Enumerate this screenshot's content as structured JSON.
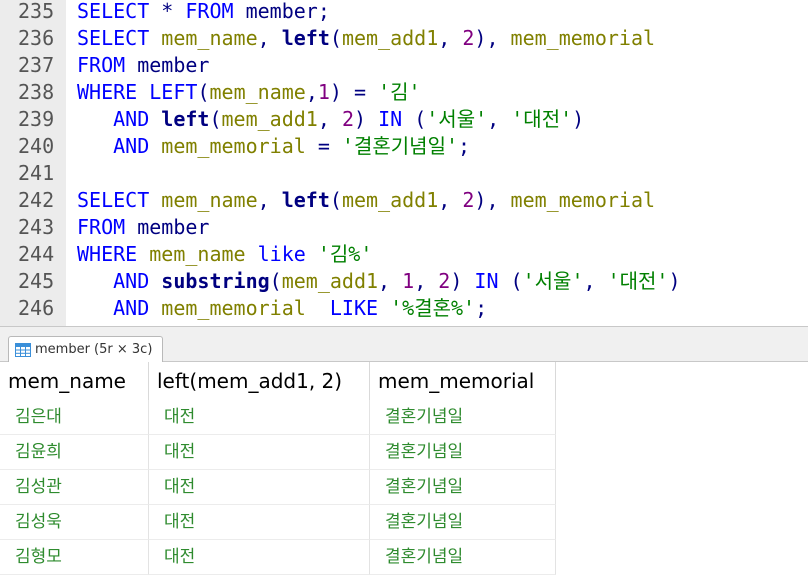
{
  "editor": {
    "lines": [
      {
        "n": "235",
        "tokens": [
          {
            "t": "SELECT",
            "c": "kw"
          },
          {
            "t": " * ",
            "c": "op"
          },
          {
            "t": "FROM",
            "c": "kw"
          },
          {
            "t": " member;",
            "c": "op"
          }
        ]
      },
      {
        "n": "236",
        "tokens": [
          {
            "t": "SELECT",
            "c": "kw"
          },
          {
            "t": " ",
            "c": "op"
          },
          {
            "t": "mem_name",
            "c": "id"
          },
          {
            "t": ", ",
            "c": "op"
          },
          {
            "t": "left",
            "c": "fn"
          },
          {
            "t": "(",
            "c": "op"
          },
          {
            "t": "mem_add1",
            "c": "id"
          },
          {
            "t": ", ",
            "c": "op"
          },
          {
            "t": "2",
            "c": "num"
          },
          {
            "t": "), ",
            "c": "op"
          },
          {
            "t": "mem_memorial",
            "c": "id"
          }
        ]
      },
      {
        "n": "237",
        "tokens": [
          {
            "t": "FROM",
            "c": "kw"
          },
          {
            "t": " member",
            "c": "op"
          }
        ]
      },
      {
        "n": "238",
        "tokens": [
          {
            "t": "WHERE",
            "c": "kw"
          },
          {
            "t": " ",
            "c": "op"
          },
          {
            "t": "LEFT",
            "c": "kw"
          },
          {
            "t": "(",
            "c": "op"
          },
          {
            "t": "mem_name",
            "c": "id"
          },
          {
            "t": ",",
            "c": "op"
          },
          {
            "t": "1",
            "c": "num"
          },
          {
            "t": ") = ",
            "c": "op"
          },
          {
            "t": "'김'",
            "c": "str"
          }
        ]
      },
      {
        "n": "239",
        "tokens": [
          {
            "t": "   ",
            "c": "op"
          },
          {
            "t": "AND",
            "c": "kw"
          },
          {
            "t": " ",
            "c": "op"
          },
          {
            "t": "left",
            "c": "fn"
          },
          {
            "t": "(",
            "c": "op"
          },
          {
            "t": "mem_add1",
            "c": "id"
          },
          {
            "t": ", ",
            "c": "op"
          },
          {
            "t": "2",
            "c": "num"
          },
          {
            "t": ") ",
            "c": "op"
          },
          {
            "t": "IN",
            "c": "kw"
          },
          {
            "t": " (",
            "c": "op"
          },
          {
            "t": "'서울'",
            "c": "str"
          },
          {
            "t": ", ",
            "c": "op"
          },
          {
            "t": "'대전'",
            "c": "str"
          },
          {
            "t": ")",
            "c": "op"
          }
        ]
      },
      {
        "n": "240",
        "tokens": [
          {
            "t": "   ",
            "c": "op"
          },
          {
            "t": "AND",
            "c": "kw"
          },
          {
            "t": " ",
            "c": "op"
          },
          {
            "t": "mem_memorial",
            "c": "id"
          },
          {
            "t": " = ",
            "c": "op"
          },
          {
            "t": "'결혼기념일'",
            "c": "str"
          },
          {
            "t": ";",
            "c": "op"
          }
        ]
      },
      {
        "n": "241",
        "tokens": []
      },
      {
        "n": "242",
        "tokens": [
          {
            "t": "SELECT",
            "c": "kw"
          },
          {
            "t": " ",
            "c": "op"
          },
          {
            "t": "mem_name",
            "c": "id"
          },
          {
            "t": ", ",
            "c": "op"
          },
          {
            "t": "left",
            "c": "fn"
          },
          {
            "t": "(",
            "c": "op"
          },
          {
            "t": "mem_add1",
            "c": "id"
          },
          {
            "t": ", ",
            "c": "op"
          },
          {
            "t": "2",
            "c": "num"
          },
          {
            "t": "), ",
            "c": "op"
          },
          {
            "t": "mem_memorial",
            "c": "id"
          }
        ]
      },
      {
        "n": "243",
        "tokens": [
          {
            "t": "FROM",
            "c": "kw"
          },
          {
            "t": " member",
            "c": "op"
          }
        ]
      },
      {
        "n": "244",
        "tokens": [
          {
            "t": "WHERE",
            "c": "kw"
          },
          {
            "t": " ",
            "c": "op"
          },
          {
            "t": "mem_name",
            "c": "id"
          },
          {
            "t": " ",
            "c": "op"
          },
          {
            "t": "like",
            "c": "kw"
          },
          {
            "t": " ",
            "c": "op"
          },
          {
            "t": "'김%'",
            "c": "str"
          }
        ]
      },
      {
        "n": "245",
        "tokens": [
          {
            "t": "   ",
            "c": "op"
          },
          {
            "t": "AND",
            "c": "kw"
          },
          {
            "t": " ",
            "c": "op"
          },
          {
            "t": "substring",
            "c": "fn"
          },
          {
            "t": "(",
            "c": "op"
          },
          {
            "t": "mem_add1",
            "c": "id"
          },
          {
            "t": ", ",
            "c": "op"
          },
          {
            "t": "1",
            "c": "num"
          },
          {
            "t": ", ",
            "c": "op"
          },
          {
            "t": "2",
            "c": "num"
          },
          {
            "t": ") ",
            "c": "op"
          },
          {
            "t": "IN",
            "c": "kw"
          },
          {
            "t": " (",
            "c": "op"
          },
          {
            "t": "'서울'",
            "c": "str"
          },
          {
            "t": ", ",
            "c": "op"
          },
          {
            "t": "'대전'",
            "c": "str"
          },
          {
            "t": ")",
            "c": "op"
          }
        ]
      },
      {
        "n": "246",
        "tokens": [
          {
            "t": "   ",
            "c": "op"
          },
          {
            "t": "AND",
            "c": "kw"
          },
          {
            "t": " ",
            "c": "op"
          },
          {
            "t": "mem_memorial",
            "c": "id"
          },
          {
            "t": "  ",
            "c": "op"
          },
          {
            "t": "LIKE",
            "c": "kw"
          },
          {
            "t": " ",
            "c": "op"
          },
          {
            "t": "'%결혼%'",
            "c": "str"
          },
          {
            "t": ";",
            "c": "op"
          }
        ]
      }
    ]
  },
  "results": {
    "tab_label": "member (5r × 3c)",
    "tab_icon": "table-grid-icon",
    "columns": [
      "mem_name",
      "left(mem_add1, 2)",
      "mem_memorial"
    ],
    "rows": [
      [
        "김은대",
        "대전",
        "결혼기념일"
      ],
      [
        "김윤희",
        "대전",
        "결혼기념일"
      ],
      [
        "김성관",
        "대전",
        "결혼기념일"
      ],
      [
        "김성욱",
        "대전",
        "결혼기념일"
      ],
      [
        "김형모",
        "대전",
        "결혼기념일"
      ]
    ]
  },
  "colors": {
    "keyword": "#0000ff",
    "identifier": "#808000",
    "number": "#800080",
    "string": "#008000",
    "result_text": "#2e8b2e"
  }
}
